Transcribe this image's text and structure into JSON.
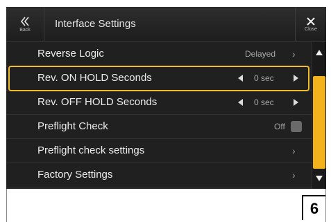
{
  "header": {
    "title": "Interface Settings",
    "back_label": "Back",
    "close_label": "Close"
  },
  "rows": [
    {
      "label": "Reverse Logic",
      "value": "Delayed"
    },
    {
      "label": "Rev. ON HOLD Seconds",
      "value": "0 sec"
    },
    {
      "label": "Rev. OFF HOLD Seconds",
      "value": "0 sec"
    },
    {
      "label": "Preflight Check",
      "value": "Off"
    },
    {
      "label": "Preflight check settings",
      "value": ""
    },
    {
      "label": "Factory Settings",
      "value": ""
    }
  ],
  "page_number": "6",
  "colors": {
    "accent": "#f1bb2a",
    "background": "#202020"
  }
}
